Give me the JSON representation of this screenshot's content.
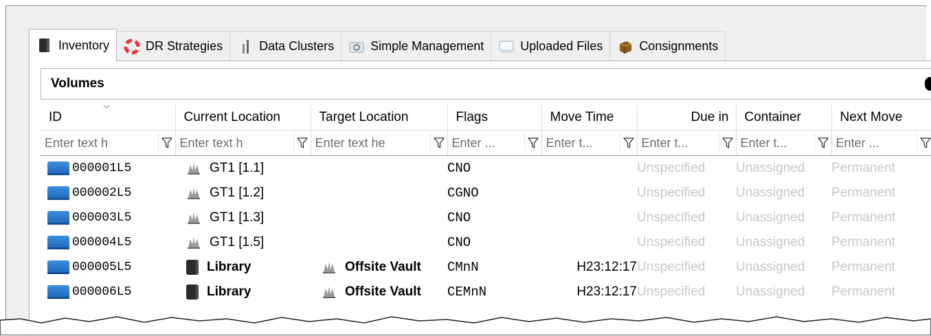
{
  "tabs": [
    {
      "label": "Inventory",
      "icon": "inventory-icon",
      "active": true
    },
    {
      "label": "DR Strategies",
      "icon": "lifebuoy-icon",
      "active": false
    },
    {
      "label": "Data Clusters",
      "icon": "data-clusters-icon",
      "active": false
    },
    {
      "label": "Simple Management",
      "icon": "simple-management-icon",
      "active": false
    },
    {
      "label": "Uploaded Files",
      "icon": "uploaded-files-icon",
      "active": false
    },
    {
      "label": "Consignments",
      "icon": "consignments-icon",
      "active": false
    }
  ],
  "group": {
    "title": "Volumes"
  },
  "columns": [
    {
      "label": "ID",
      "filter": "Enter text h"
    },
    {
      "label": "Current Location",
      "filter": "Enter text h"
    },
    {
      "label": "Target Location",
      "filter": "Enter text he"
    },
    {
      "label": "Flags",
      "filter": "Enter ..."
    },
    {
      "label": "Move Time",
      "filter": "Enter t..."
    },
    {
      "label": "Due in",
      "filter": "Enter t..."
    },
    {
      "label": "Container",
      "filter": "Enter t..."
    },
    {
      "label": "Next Move",
      "filter": "Enter ..."
    }
  ],
  "rows": [
    {
      "id": "000001L5",
      "current": "GT1 [1.1]",
      "current_icon": "vault-icon",
      "current_bold": false,
      "target": "",
      "target_icon": "",
      "flags": "CNO",
      "move_time": "",
      "due_in": "Unspecified",
      "container": "Unassigned",
      "next_move": "Permanent"
    },
    {
      "id": "000002L5",
      "current": "GT1 [1.2]",
      "current_icon": "vault-icon",
      "current_bold": false,
      "target": "",
      "target_icon": "",
      "flags": "CGNO",
      "move_time": "",
      "due_in": "Unspecified",
      "container": "Unassigned",
      "next_move": "Permanent"
    },
    {
      "id": "000003L5",
      "current": "GT1 [1.3]",
      "current_icon": "vault-icon",
      "current_bold": false,
      "target": "",
      "target_icon": "",
      "flags": "CNO",
      "move_time": "",
      "due_in": "Unspecified",
      "container": "Unassigned",
      "next_move": "Permanent"
    },
    {
      "id": "000004L5",
      "current": "GT1 [1.5]",
      "current_icon": "vault-icon",
      "current_bold": false,
      "target": "",
      "target_icon": "",
      "flags": "CNO",
      "move_time": "",
      "due_in": "Unspecified",
      "container": "Unassigned",
      "next_move": "Permanent"
    },
    {
      "id": "000005L5",
      "current": "Library",
      "current_icon": "library-icon",
      "current_bold": true,
      "target": "Offsite Vault",
      "target_icon": "vault-icon",
      "flags": "CMnN",
      "move_time": "H23:12:17",
      "due_in": "Unspecified",
      "container": "Unassigned",
      "next_move": "Permanent"
    },
    {
      "id": "000006L5",
      "current": "Library",
      "current_icon": "library-icon",
      "current_bold": true,
      "target": "Offsite Vault",
      "target_icon": "vault-icon",
      "flags": "CEMnN",
      "move_time": "H23:12:17",
      "due_in": "Unspecified",
      "container": "Unassigned",
      "next_move": "Permanent"
    }
  ],
  "colors": {
    "muted_text": "#c8c8c8",
    "cart_blue": "#2a7bd3"
  }
}
